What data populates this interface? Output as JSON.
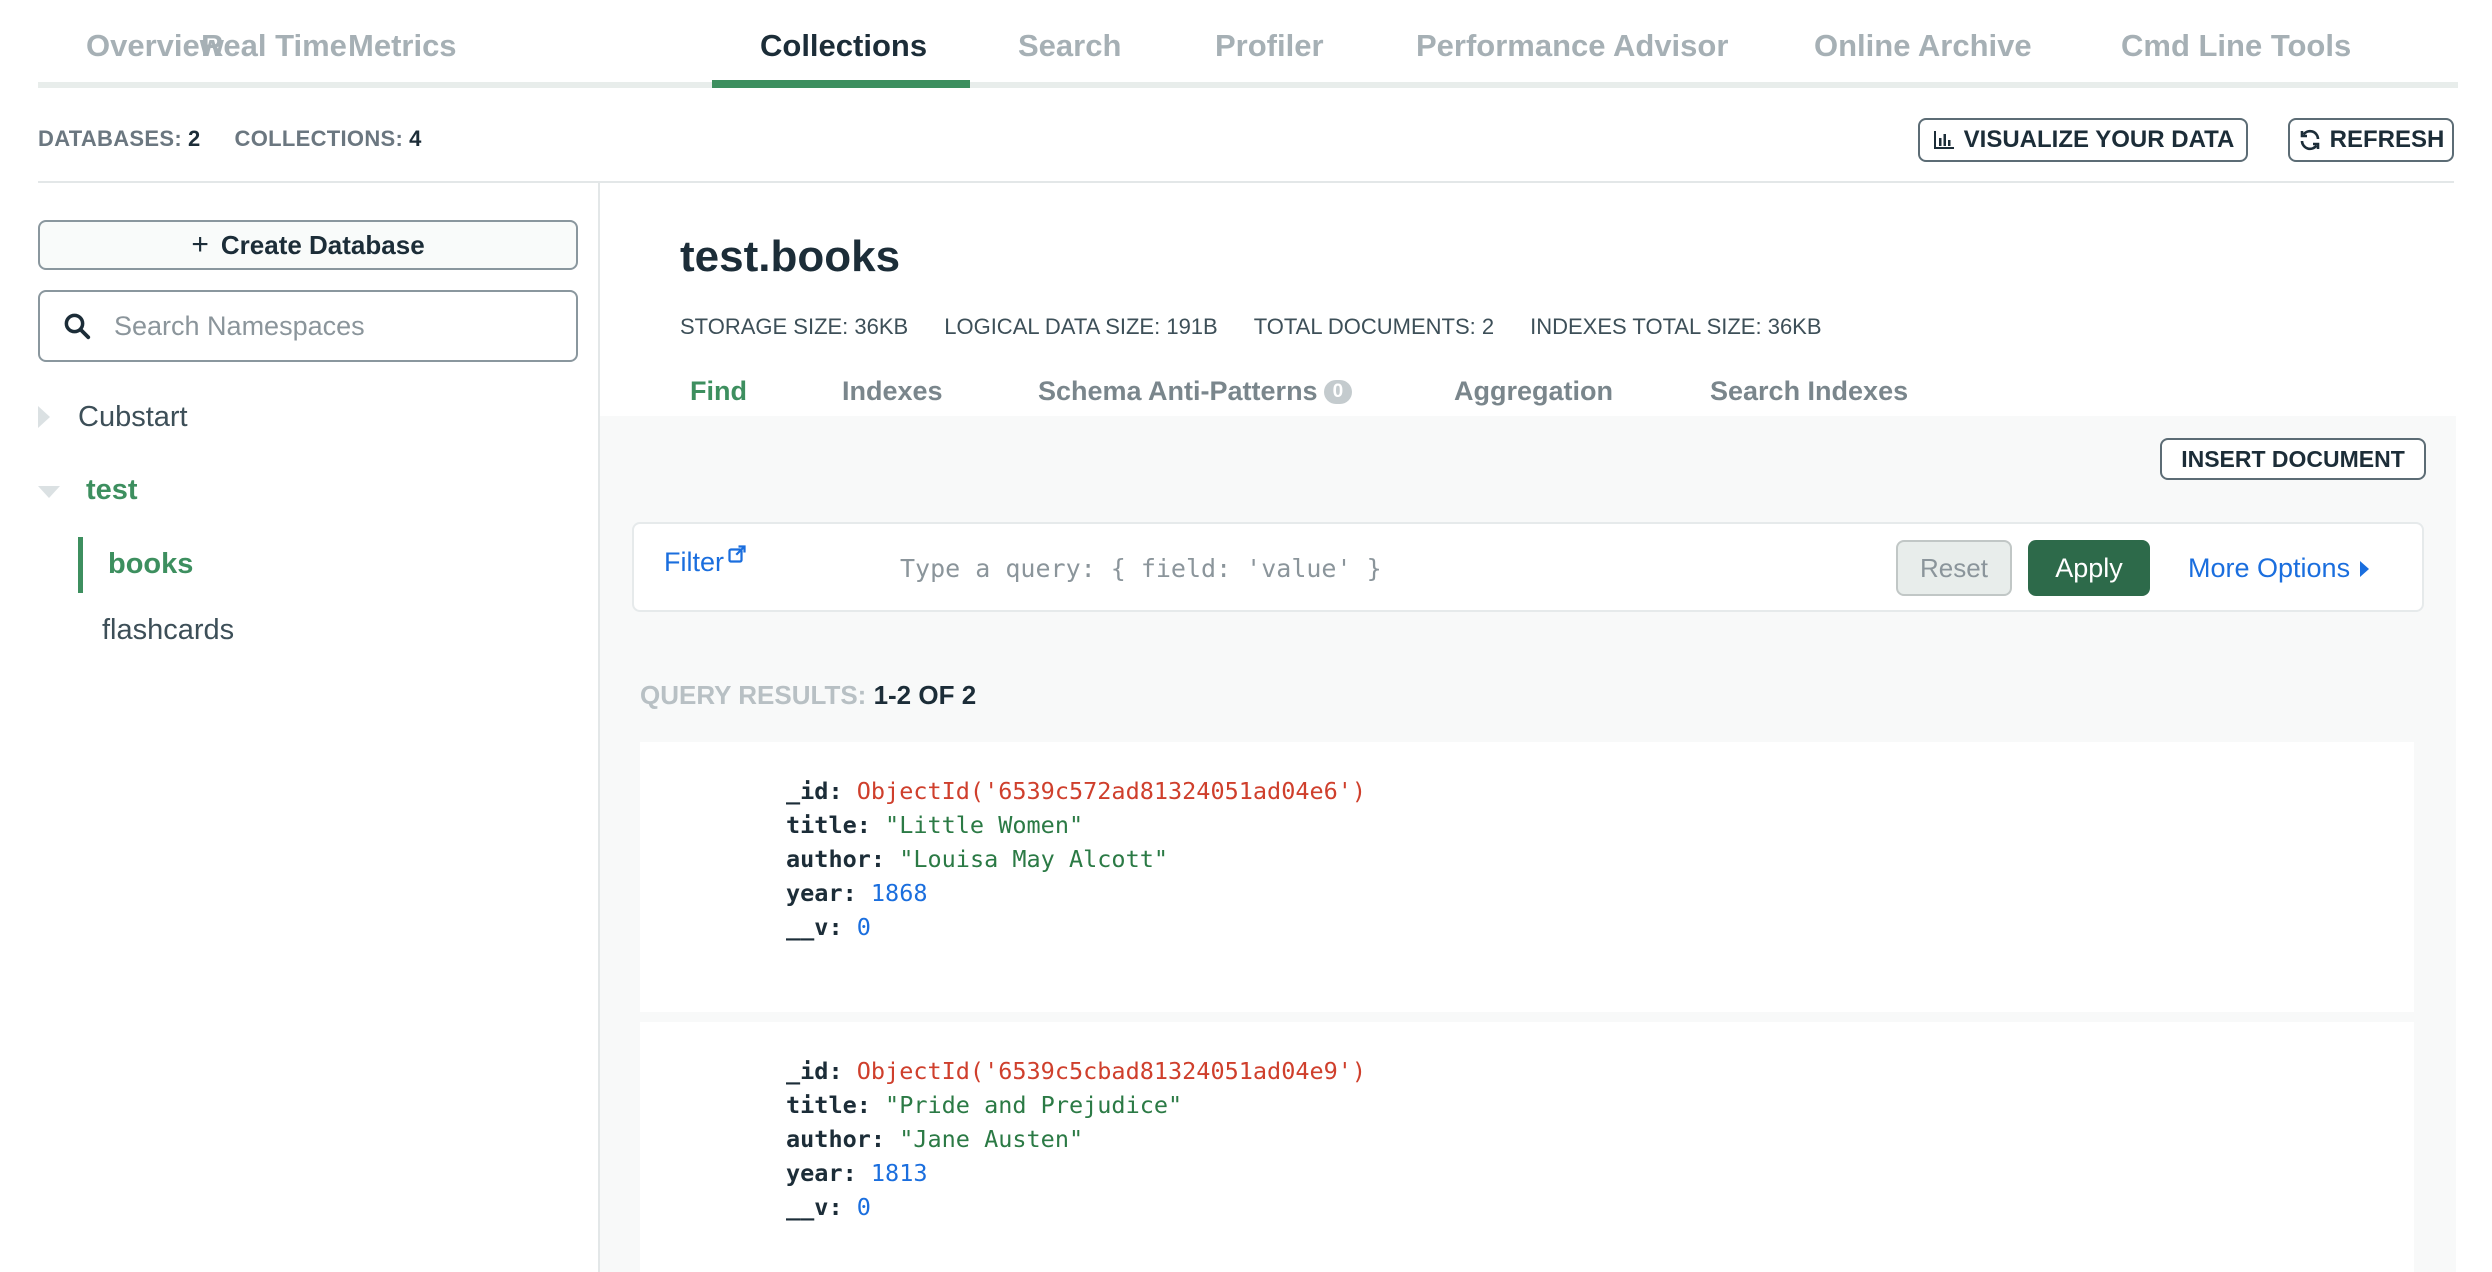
{
  "top_tabs": [
    "Overview",
    "Real Time",
    "Metrics",
    "Collections",
    "Search",
    "Profiler",
    "Performance Advisor",
    "Online Archive",
    "Cmd Line Tools"
  ],
  "active_top_tab": "Collections",
  "stats": {
    "databases_label": "DATABASES:",
    "databases_count": "2",
    "collections_label": "COLLECTIONS:",
    "collections_count": "4"
  },
  "header_buttons": {
    "visualize": "VISUALIZE YOUR DATA",
    "refresh": "REFRESH"
  },
  "sidebar": {
    "create_database": "Create Database",
    "search_placeholder": "Search Namespaces",
    "databases": [
      {
        "name": "Cubstart",
        "expanded": false
      },
      {
        "name": "test",
        "expanded": true,
        "collections": [
          "books",
          "flashcards"
        ]
      }
    ],
    "active_collection": "books"
  },
  "namespace": {
    "title": "test.books",
    "storage_size": "STORAGE SIZE: 36KB",
    "logical_size": "LOGICAL DATA SIZE: 191B",
    "total_documents": "TOTAL DOCUMENTS: 2",
    "indexes_size": "INDEXES TOTAL SIZE: 36KB"
  },
  "sub_tabs": {
    "find": "Find",
    "indexes": "Indexes",
    "schema": "Schema Anti-Patterns",
    "schema_count": "0",
    "aggregation": "Aggregation",
    "search_indexes": "Search Indexes",
    "active": "Find"
  },
  "find": {
    "insert_document": "INSERT DOCUMENT",
    "filter_label": "Filter",
    "query_placeholder": "Type a query: { field: 'value' }",
    "reset": "Reset",
    "apply": "Apply",
    "more_options": "More Options",
    "results_label": "QUERY RESULTS:",
    "results_range": "1-2 OF 2"
  },
  "documents": [
    {
      "id": "ObjectId('6539c572ad81324051ad04e6')",
      "title": "\"Little Women\"",
      "author": "\"Louisa May Alcott\"",
      "year": "1868",
      "v": "0"
    },
    {
      "id": "ObjectId('6539c5cbad81324051ad04e9')",
      "title": "\"Pride and Prejudice\"",
      "author": "\"Jane Austen\"",
      "year": "1813",
      "v": "0"
    }
  ],
  "field_keys": {
    "id": "_id:",
    "title": "title:",
    "author": "author:",
    "year": "year:",
    "v": "__v:"
  },
  "colors": {
    "brand_green": "#3d8f5f",
    "apply_green": "#2d6a4a",
    "link_blue": "#1a6ede",
    "objectid_red": "#cf3f2c",
    "string_green": "#2b7a45"
  }
}
